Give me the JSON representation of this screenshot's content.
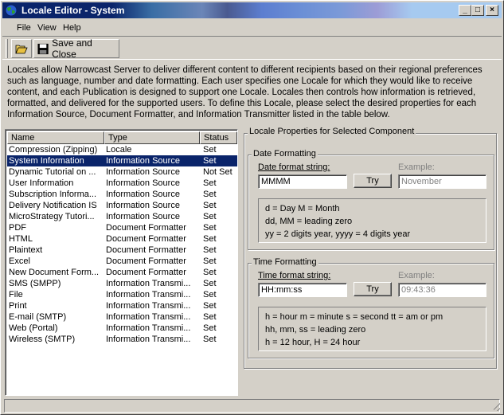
{
  "window": {
    "title": "Locale Editor - System"
  },
  "title_buttons": {
    "minimize": "_",
    "maximize": "□",
    "close": "×"
  },
  "menu": {
    "items": [
      "File",
      "View",
      "Help"
    ]
  },
  "toolbar": {
    "save_close_label": "Save and Close"
  },
  "description": "Locales allow Narrowcast Server to deliver different content to different recipients based on their regional preferences such as language, number and date formatting. Each user specifies one Locale for which they would like to receive content, and each Publication is designed to support one Locale. Locales then controls how information is retrieved, formatted, and delivered for the supported users. To define this Locale, please select the desired properties for each Information Source, Document Formatter, and Information Transmitter listed in the table below.",
  "table": {
    "columns": [
      "Name",
      "Type",
      "Status"
    ],
    "rows": [
      {
        "name": "Compression (Zipping)",
        "type": "Locale",
        "status": "Set",
        "selected": false
      },
      {
        "name": "System Information",
        "type": "Information Source",
        "status": "Set",
        "selected": true
      },
      {
        "name": "Dynamic Tutorial on ...",
        "type": "Information Source",
        "status": "Not Set",
        "selected": false
      },
      {
        "name": "User Information",
        "type": "Information Source",
        "status": "Set",
        "selected": false
      },
      {
        "name": "Subscription Informa...",
        "type": "Information Source",
        "status": "Set",
        "selected": false
      },
      {
        "name": "Delivery Notification IS",
        "type": "Information Source",
        "status": "Set",
        "selected": false
      },
      {
        "name": "MicroStrategy Tutori...",
        "type": "Information Source",
        "status": "Set",
        "selected": false
      },
      {
        "name": "PDF",
        "type": "Document Formatter",
        "status": "Set",
        "selected": false
      },
      {
        "name": "HTML",
        "type": "Document Formatter",
        "status": "Set",
        "selected": false
      },
      {
        "name": "Plaintext",
        "type": "Document Formatter",
        "status": "Set",
        "selected": false
      },
      {
        "name": "Excel",
        "type": "Document Formatter",
        "status": "Set",
        "selected": false
      },
      {
        "name": "New Document Form...",
        "type": "Document Formatter",
        "status": "Set",
        "selected": false
      },
      {
        "name": "SMS (SMPP)",
        "type": "Information Transmi...",
        "status": "Set",
        "selected": false
      },
      {
        "name": "File",
        "type": "Information Transmi...",
        "status": "Set",
        "selected": false
      },
      {
        "name": "Print",
        "type": "Information Transmi...",
        "status": "Set",
        "selected": false
      },
      {
        "name": "E-mail (SMTP)",
        "type": "Information Transmi...",
        "status": "Set",
        "selected": false
      },
      {
        "name": "Web (Portal)",
        "type": "Information Transmi...",
        "status": "Set",
        "selected": false
      },
      {
        "name": "Wireless (SMTP)",
        "type": "Information Transmi...",
        "status": "Set",
        "selected": false
      }
    ]
  },
  "properties": {
    "title": "Locale Properties for Selected Component",
    "date": {
      "group_label": "Date Formatting",
      "format_label": "Date format string:",
      "format_value": "MMMM",
      "try_label": "Try",
      "example_label": "Example:",
      "example_value": "November",
      "info": [
        "d = Day   M = Month",
        "dd, MM = leading zero",
        "yy = 2 digits year, yyyy = 4 digits year"
      ]
    },
    "time": {
      "group_label": "Time Formatting",
      "format_label": "Time format string:",
      "format_value": "HH:mm:ss",
      "try_label": "Try",
      "example_label": "Example:",
      "example_value": "09:43:36",
      "info": [
        "h = hour    m = minute    s = second   tt = am or pm",
        "hh, mm, ss = leading zero",
        "h = 12 hour,  H = 24 hour"
      ]
    }
  },
  "colors": {
    "selection": "#0a246a",
    "face": "#d4d0c8",
    "title_start": "#0a246a"
  }
}
